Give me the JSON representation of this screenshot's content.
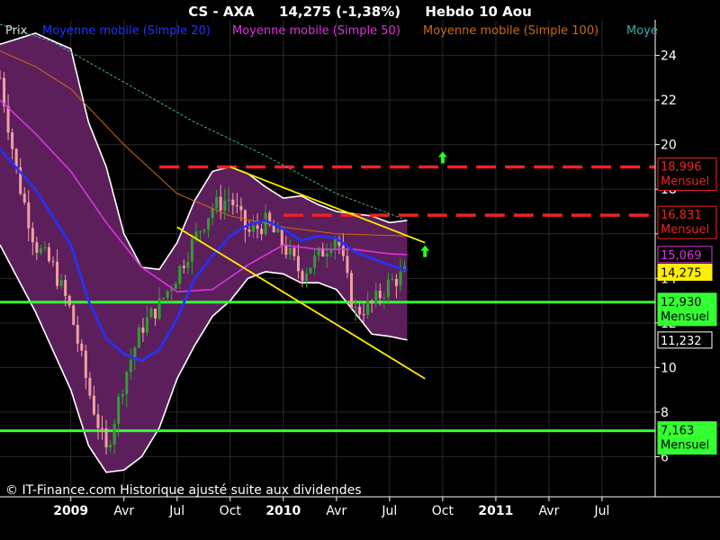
{
  "header": {
    "title": "CS - AXA",
    "price": "14,275 (-1,38%)",
    "period": "Hebdo  10 Aou"
  },
  "legend": [
    {
      "label": "Prix",
      "color": "#d8d8d8"
    },
    {
      "label": "Moyenne mobile (Simple 20)",
      "color": "#2233ff"
    },
    {
      "label": "Moyenne mobile (Simple 50)",
      "color": "#dd33dd"
    },
    {
      "label": "Moyenne mobile (Simple 100)",
      "color": "#cc6a10"
    },
    {
      "label": "Moye",
      "color": "#44aaaa"
    }
  ],
  "credit": "© IT-Finance.com Historique ajusté suite aux dividendes",
  "colors": {
    "background": "#000000",
    "grid": "#2a2a2a",
    "bollinger_fill": "#5c1f5c",
    "bollinger_band": "#ffffff",
    "candle_up": "#2fa02f",
    "candle_down": "#f0a0a0",
    "sma20": "#2233ff",
    "sma50": "#dd33dd",
    "sma100": "#cc6a10",
    "sma200": "#44aaaa",
    "channel": "#ffee00",
    "resistance": "#ee2222",
    "support": "#33ff33",
    "arrow": "#22ff22"
  },
  "chart_data": {
    "type": "candlestick",
    "ylim": [
      4.2,
      25.6
    ],
    "x_range": [
      "2008-09",
      "2011-10"
    ],
    "y_ticks": [
      {
        "value": 6,
        "label": "6"
      },
      {
        "value": 8,
        "label": "8"
      },
      {
        "value": 10,
        "label": "10"
      },
      {
        "value": 12,
        "label": "12"
      },
      {
        "value": 14,
        "label": "14"
      },
      {
        "value": 16,
        "label": "16"
      },
      {
        "value": 18,
        "label": "18"
      },
      {
        "value": 20,
        "label": "20"
      },
      {
        "value": 22,
        "label": "22"
      },
      {
        "value": 24,
        "label": "24"
      }
    ],
    "x_ticks": [
      {
        "date": "2009-01",
        "label": "2009",
        "bold": true
      },
      {
        "date": "2009-04",
        "label": "Avr",
        "bold": false
      },
      {
        "date": "2009-07",
        "label": "Jul",
        "bold": false
      },
      {
        "date": "2009-10",
        "label": "Oct",
        "bold": false
      },
      {
        "date": "2010-01",
        "label": "2010",
        "bold": true
      },
      {
        "date": "2010-04",
        "label": "Avr",
        "bold": false
      },
      {
        "date": "2010-07",
        "label": "Jul",
        "bold": false
      },
      {
        "date": "2010-10",
        "label": "Oct",
        "bold": false
      },
      {
        "date": "2011-01",
        "label": "2011",
        "bold": true
      },
      {
        "date": "2011-04",
        "label": "Avr",
        "bold": false
      },
      {
        "date": "2011-07",
        "label": "Jul",
        "bold": false
      }
    ],
    "price_closes": [
      [
        "2008-09",
        23.0
      ],
      [
        "2008-10",
        18.5
      ],
      [
        "2008-11",
        15.5
      ],
      [
        "2008-12",
        14.5
      ],
      [
        "2009-01",
        12.5
      ],
      [
        "2009-02",
        9.0
      ],
      [
        "2009-03",
        6.2
      ],
      [
        "2009-04",
        9.5
      ],
      [
        "2009-05",
        11.8
      ],
      [
        "2009-06",
        12.8
      ],
      [
        "2009-07",
        14.2
      ],
      [
        "2009-08",
        15.8
      ],
      [
        "2009-09",
        17.2
      ],
      [
        "2009-10",
        17.6
      ],
      [
        "2009-11",
        16.0
      ],
      [
        "2009-12",
        16.5
      ],
      [
        "2010-01",
        15.5
      ],
      [
        "2010-02",
        14.2
      ],
      [
        "2010-03",
        15.0
      ],
      [
        "2010-04",
        16.0
      ],
      [
        "2010-05",
        12.5
      ],
      [
        "2010-06",
        12.8
      ],
      [
        "2010-07",
        13.8
      ],
      [
        "2010-08",
        14.275
      ]
    ],
    "series": [
      {
        "name": "Moyenne mobile (Simple 20)",
        "key": "sma20",
        "points": [
          [
            "2008-09",
            19.8
          ],
          [
            "2008-11",
            18.0
          ],
          [
            "2009-01",
            15.5
          ],
          [
            "2009-02",
            13.0
          ],
          [
            "2009-03",
            11.3
          ],
          [
            "2009-04",
            10.6
          ],
          [
            "2009-05",
            10.3
          ],
          [
            "2009-06",
            10.8
          ],
          [
            "2009-07",
            12.2
          ],
          [
            "2009-08",
            14.0
          ],
          [
            "2009-09",
            15.0
          ],
          [
            "2009-10",
            15.9
          ],
          [
            "2009-11",
            16.4
          ],
          [
            "2009-12",
            16.6
          ],
          [
            "2010-01",
            16.2
          ],
          [
            "2010-02",
            15.7
          ],
          [
            "2010-03",
            15.9
          ],
          [
            "2010-04",
            15.8
          ],
          [
            "2010-05",
            15.2
          ],
          [
            "2010-06",
            14.9
          ],
          [
            "2010-07",
            14.6
          ],
          [
            "2010-08",
            14.35
          ]
        ]
      },
      {
        "name": "Moyenne mobile (Simple 50)",
        "key": "sma50",
        "points": [
          [
            "2008-09",
            22.0
          ],
          [
            "2008-11",
            20.5
          ],
          [
            "2009-01",
            18.8
          ],
          [
            "2009-03",
            16.5
          ],
          [
            "2009-05",
            14.5
          ],
          [
            "2009-07",
            13.4
          ],
          [
            "2009-09",
            13.5
          ],
          [
            "2009-11",
            14.6
          ],
          [
            "2010-01",
            15.5
          ],
          [
            "2010-03",
            15.3
          ],
          [
            "2010-05",
            15.3
          ],
          [
            "2010-07",
            15.1
          ],
          [
            "2010-08",
            15.069
          ]
        ]
      },
      {
        "name": "Moyenne mobile (Simple 100)",
        "key": "sma100",
        "points": [
          [
            "2008-09",
            24.2
          ],
          [
            "2008-11",
            23.5
          ],
          [
            "2009-01",
            22.5
          ],
          [
            "2009-04",
            20.0
          ],
          [
            "2009-07",
            17.8
          ],
          [
            "2009-10",
            16.8
          ],
          [
            "2010-01",
            16.3
          ],
          [
            "2010-04",
            16.0
          ],
          [
            "2010-08",
            15.9
          ]
        ]
      },
      {
        "name": "Moye",
        "key": "sma200",
        "points": [
          [
            "2008-09",
            25.4
          ],
          [
            "2008-12",
            24.6
          ],
          [
            "2009-04",
            22.8
          ],
          [
            "2009-08",
            21.0
          ],
          [
            "2009-12",
            19.5
          ],
          [
            "2010-04",
            17.8
          ],
          [
            "2010-08",
            16.6
          ]
        ]
      },
      {
        "name": "",
        "key": "boll_upper",
        "points": [
          [
            "2008-09",
            24.5
          ],
          [
            "2008-11",
            25.0
          ],
          [
            "2009-01",
            24.3
          ],
          [
            "2009-02",
            21.0
          ],
          [
            "2009-03",
            19.0
          ],
          [
            "2009-04",
            16.0
          ],
          [
            "2009-05",
            14.5
          ],
          [
            "2009-06",
            14.4
          ],
          [
            "2009-07",
            15.6
          ],
          [
            "2009-08",
            17.5
          ],
          [
            "2009-09",
            18.8
          ],
          [
            "2009-10",
            19.0
          ],
          [
            "2009-11",
            18.7
          ],
          [
            "2009-12",
            18.1
          ],
          [
            "2010-01",
            17.6
          ],
          [
            "2010-02",
            17.7
          ],
          [
            "2010-03",
            17.3
          ],
          [
            "2010-04",
            17.0
          ],
          [
            "2010-05",
            16.9
          ],
          [
            "2010-06",
            16.8
          ],
          [
            "2010-07",
            16.5
          ],
          [
            "2010-08",
            16.6
          ]
        ]
      },
      {
        "name": "",
        "key": "boll_lower",
        "points": [
          [
            "2008-09",
            15.5
          ],
          [
            "2008-11",
            12.5
          ],
          [
            "2009-01",
            9.0
          ],
          [
            "2009-02",
            6.5
          ],
          [
            "2009-03",
            5.3
          ],
          [
            "2009-04",
            5.4
          ],
          [
            "2009-05",
            6.0
          ],
          [
            "2009-06",
            7.3
          ],
          [
            "2009-07",
            9.5
          ],
          [
            "2009-08",
            11.0
          ],
          [
            "2009-09",
            12.3
          ],
          [
            "2009-10",
            13.0
          ],
          [
            "2009-11",
            14.0
          ],
          [
            "2009-12",
            14.3
          ],
          [
            "2010-01",
            14.2
          ],
          [
            "2010-02",
            13.8
          ],
          [
            "2010-03",
            13.8
          ],
          [
            "2010-04",
            13.5
          ],
          [
            "2010-05",
            12.5
          ],
          [
            "2010-06",
            11.5
          ],
          [
            "2010-07",
            11.4
          ],
          [
            "2010-08",
            11.232
          ]
        ]
      }
    ],
    "levels": [
      {
        "value": 18.996,
        "label": "18,996",
        "sublabel": "Mensuel",
        "style": "resistance",
        "line_from": "2009-06"
      },
      {
        "value": 16.831,
        "label": "16,831",
        "sublabel": "Mensuel",
        "style": "resistance",
        "line_from": "2010-01"
      },
      {
        "value": 12.93,
        "label": "12,930",
        "sublabel": "Mensuel",
        "style": "support",
        "line_from": "2008-09"
      },
      {
        "value": 7.163,
        "label": "7,163",
        "sublabel": "Mensuel",
        "style": "support",
        "line_from": "2008-09"
      }
    ],
    "value_tags": [
      {
        "value": 15.069,
        "label": "15,069",
        "color": "#dd33dd"
      },
      {
        "value": 14.275,
        "label": "14,275",
        "color": "#ffee00"
      },
      {
        "value": 11.232,
        "label": "11,232",
        "color": "#ffffff"
      }
    ],
    "channel_lines": [
      {
        "from": [
          "2009-10",
          19.0
        ],
        "to": [
          "2010-09",
          15.6
        ]
      },
      {
        "from": [
          "2009-07",
          16.3
        ],
        "to": [
          "2010-09",
          9.5
        ]
      }
    ],
    "arrows": [
      {
        "date": "2010-10",
        "value": 19.4
      },
      {
        "date": "2010-09",
        "value": 15.2
      }
    ]
  }
}
